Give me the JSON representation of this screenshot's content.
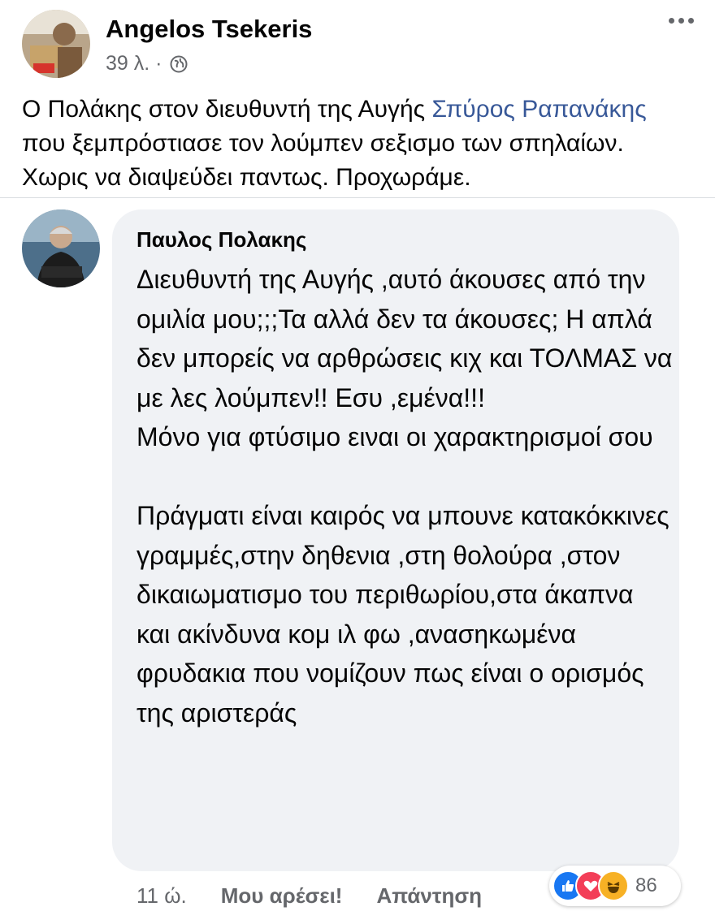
{
  "post": {
    "author": "Angelos Tsekeris",
    "time": "39 λ. ·",
    "text_before": "Ο Πολάκης στον διευθυντή της Αυγής ",
    "link_text": "Σπύρος Ραπανάκης",
    "text_after": " που ξεμπρόστιασε τον λούμπεν σεξισμο των σπηλαίων. Χωρις να διαψεύδει παντως. Προχωράμε."
  },
  "comment": {
    "author": "Παυλος Πολακης",
    "text": "Διευθυντή της Αυγής ,αυτό άκουσες από την ομιλία μου;;;Τα αλλά δεν τα άκουσες; Η απλά δεν μπορείς να αρθρώσεις κιχ και ΤΟΛΜΑΣ να με λες λούμπεν!! Εσυ ,εμένα!!!\nΜόνο για φτύσιμο ειναι οι χαρακτηρισμοί σου\n\nΠράγματι είναι καιρός να μπουνε κατακόκκινες γραμμές,στην δηθενια ,στη θολούρα ,στον δικαιωματισμο του περιθωρίου,στα άκαπνα  και ακίνδυνα κομ ιλ φω ,ανασηκωμένα φρυδακια  που νομίζουν πως είναι ο ορισμός της αριστεράς",
    "time": "11 ώ.",
    "like_label": "Μου αρέσει!",
    "reply_label": "Απάντηση",
    "reaction_count": "86",
    "reactions": [
      "like-icon",
      "love-icon",
      "haha-icon"
    ]
  },
  "colors": {
    "link": "#385898",
    "like": "#1877f2",
    "love": "#f33e58",
    "haha": "#f7b125",
    "bubble": "#f0f2f5"
  }
}
